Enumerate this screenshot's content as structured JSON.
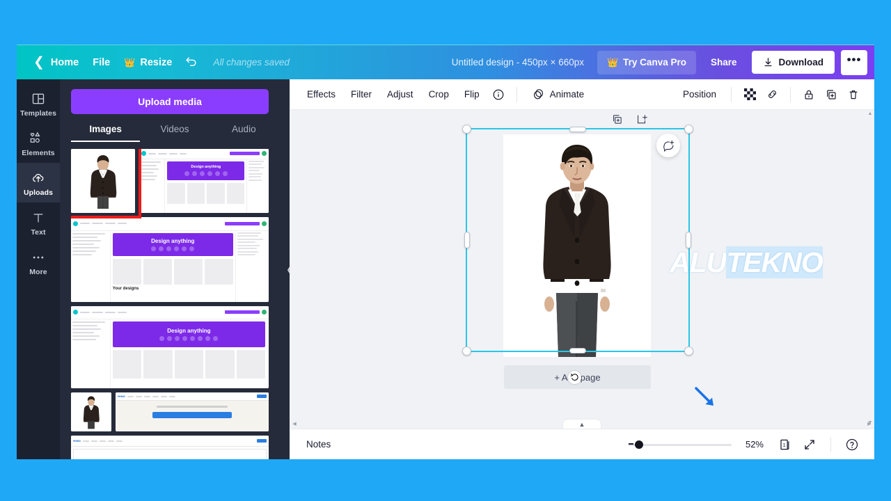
{
  "frame": {
    "background": "#1fa8f5"
  },
  "topbar": {
    "back_icon": "chevron-left-icon",
    "home_label": "Home",
    "file_label": "File",
    "resize_label": "Resize",
    "resize_icon": "crown-icon",
    "undo_icon": "undo-icon",
    "saved_status": "All changes saved",
    "doc_title": "Untitled design - 450px × 660px",
    "try_pro_label": "Try Canva Pro",
    "try_pro_icon": "crown-icon",
    "share_label": "Share",
    "download_label": "Download",
    "download_icon": "download-icon",
    "more_label": "•••",
    "accent_purple": "#8b3dff"
  },
  "rail": {
    "items": [
      {
        "label": "Templates",
        "icon": "templates-icon",
        "active": false
      },
      {
        "label": "Elements",
        "icon": "elements-icon",
        "active": false
      },
      {
        "label": "Uploads",
        "icon": "cloud-upload-icon",
        "active": true
      },
      {
        "label": "Text",
        "icon": "text-icon",
        "active": false
      },
      {
        "label": "More",
        "icon": "more-dots-icon",
        "active": false
      }
    ]
  },
  "panel": {
    "upload_button": "Upload media",
    "tabs": [
      {
        "label": "Images",
        "active": true
      },
      {
        "label": "Videos",
        "active": false
      },
      {
        "label": "Audio",
        "active": false
      }
    ],
    "highlight_color": "#ee1c1c",
    "collapse_icon": "chevron-left-icon",
    "thumbnails": [
      {
        "name": "man-in-suit-photo",
        "type": "photo",
        "selected": true
      },
      {
        "name": "canva-homepage-screenshot",
        "type": "canva-ui"
      },
      {
        "name": "canva-homepage-screenshot-2",
        "type": "canva-ui"
      },
      {
        "name": "canva-homepage-screenshot-3",
        "type": "canva-ui"
      },
      {
        "name": "man-in-suit-photo-2",
        "type": "photo"
      },
      {
        "name": "iloveimg-cropped-screenshot",
        "type": "iloveimg"
      },
      {
        "name": "iloveimg-tool-screenshot",
        "type": "iloveimg"
      }
    ],
    "mini": {
      "banner_title": "Design anything",
      "section_title": "Your designs",
      "iloveimg_logo": "I♥IMG"
    }
  },
  "editor_toolbar": {
    "left_items": [
      {
        "label": "Effects"
      },
      {
        "label": "Filter"
      },
      {
        "label": "Adjust"
      },
      {
        "label": "Crop"
      },
      {
        "label": "Flip"
      }
    ],
    "info_icon": "info-circle-icon",
    "animate_label": "Animate",
    "animate_icon": "animate-icon",
    "position_label": "Position",
    "right_icons": [
      {
        "name": "transparency-icon"
      },
      {
        "name": "link-icon"
      },
      {
        "name": "lock-icon"
      },
      {
        "name": "duplicate-icon"
      },
      {
        "name": "trash-icon"
      }
    ]
  },
  "canvas": {
    "page_tools": [
      {
        "name": "duplicate-page-icon"
      },
      {
        "name": "add-page-icon"
      }
    ],
    "comment_icon": "add-comment-icon",
    "add_page_label": "+ Add page",
    "rotate_cursor_icon": "rotate-cursor-icon",
    "selection_color": "#29c6e8",
    "arrow_annotation_color": "#1a73e8",
    "watermark_text": "ALUTEKNO",
    "watermark_prefix": "ALU",
    "watermark_highlight": "TEKNO",
    "notes_handle_icon": "chevron-up-icon"
  },
  "bottombar": {
    "notes_label": "Notes",
    "zoom_value": "52%",
    "zoom_percent": 52,
    "page_number": "1",
    "page_icon": "pages-icon",
    "expand_icon": "expand-icon",
    "help_icon": "help-circle-icon"
  }
}
